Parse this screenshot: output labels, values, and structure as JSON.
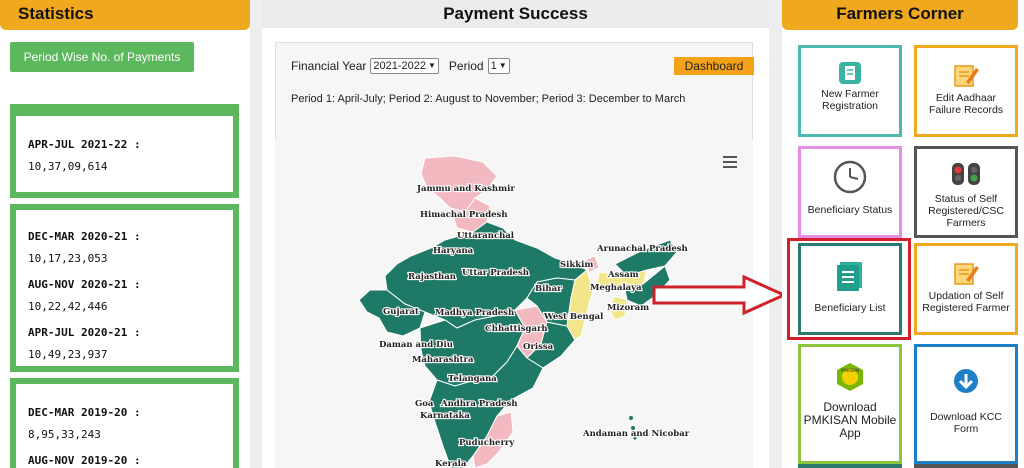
{
  "statistics": {
    "title": "Statistics",
    "period_button": "Period Wise No. of Payments",
    "boxes": [
      {
        "rows": [
          {
            "label": "APR-JUL 2021-22  :",
            "value": "10,37,09,614"
          }
        ]
      },
      {
        "rows": [
          {
            "label": "DEC-MAR 2020-21  :",
            "value": "10,17,23,053"
          },
          {
            "label": "AUG-NOV 2020-21  :",
            "value": "10,22,42,446"
          },
          {
            "label": "APR-JUL 2020-21  :",
            "value": "10,49,23,937"
          }
        ]
      },
      {
        "rows": [
          {
            "label": "DEC-MAR 2019-20  :",
            "value": "8,95,33,243"
          },
          {
            "label": "AUG-NOV 2019-20  :",
            "value": ""
          }
        ]
      }
    ]
  },
  "payment": {
    "title": "Payment Success",
    "fy_label": "Financial Year",
    "fy_value": "2021-2022",
    "period_label": "Period",
    "period_value": "1",
    "dashboard_button": "Dashboard",
    "note": "Period 1: April-July; Period 2: August to November; Period 3: December to March",
    "map_labels": {
      "jk": "Jammu and Kashmir",
      "hp": "Himachal Pradesh",
      "uttaranchal": "Uttaranchal",
      "haryana": "Haryana",
      "rajasthan": "Rajasthan",
      "up": "Uttar Pradesh",
      "sikkim": "Sikkim",
      "arunachal": "Arunachal Pradesh",
      "assam": "Assam",
      "bihar": "Bihar",
      "meghalaya": "Meghalaya",
      "gujarat": "Gujarat",
      "mp": "Madhya Pradesh",
      "wb": "West Bengal",
      "mizoram": "Mizoram",
      "chhattisgarh": "Chhattisgarh",
      "daman": "Daman and Diu",
      "orissa": "Orissa",
      "maharashtra": "Maharashtra",
      "telangana": "Telangana",
      "goa": "Goa",
      "ap": "Andhra Pradesh",
      "karnataka": "Karnataka",
      "puducherry": "Puducherry",
      "andaman": "Andaman and Nicobar",
      "kerala": "Kerala"
    }
  },
  "farmers_corner": {
    "title": "Farmers Corner",
    "cards": [
      {
        "label": "New Farmer Registration",
        "icon": "form-icon",
        "border": "#4fb8b0"
      },
      {
        "label": "Edit Aadhaar Failure Records",
        "icon": "edit-icon",
        "border": "#f0a81f"
      },
      {
        "label": "Beneficiary Status",
        "icon": "clock-icon",
        "border": "#e58ee5"
      },
      {
        "label": "Status of Self Registered/CSC Farmers",
        "icon": "traffic-light-icon",
        "border": "#555555"
      },
      {
        "label": "Beneficiary List",
        "icon": "list-icon",
        "border": "#2c7a6e"
      },
      {
        "label": "Updation of Self Registered Farmer",
        "icon": "edit-icon",
        "border": "#f0a81f"
      },
      {
        "label": "Download PMKISAN Mobile App",
        "icon": "app-icon",
        "border": "#8cc63f"
      },
      {
        "label": "Download KCC Form",
        "icon": "download-icon",
        "border": "#1e7fc6"
      }
    ]
  },
  "colors": {
    "accent_orange": "#f0a81f",
    "green": "#5cb85c",
    "map_green": "#1e7a67",
    "map_pink": "#f2b9c0",
    "map_yellow": "#f2e58a",
    "highlight_red": "#d0202a"
  }
}
